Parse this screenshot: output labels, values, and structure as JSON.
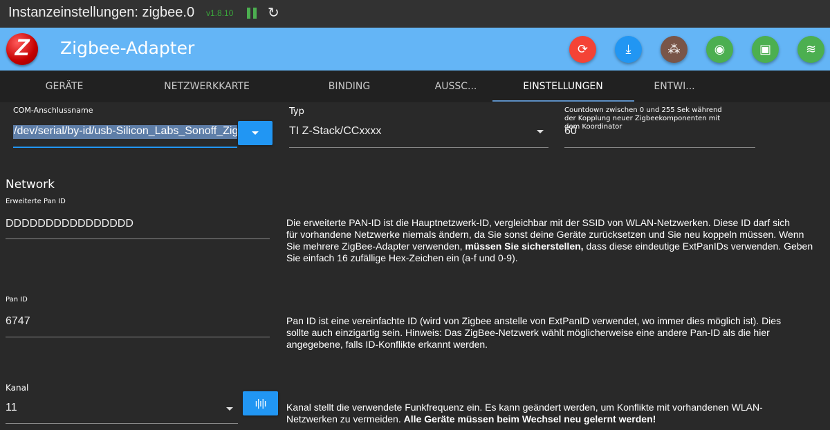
{
  "titlebar": {
    "title": "Instanzeinstellungen: zigbee.0",
    "version": "v1.8.10"
  },
  "header": {
    "logo_letter": "Z",
    "app_name": "Zigbee-Adapter",
    "actions": [
      {
        "icon": "sync-icon",
        "color": "#f44336",
        "glyph": "⟳"
      },
      {
        "icon": "phone-download-icon",
        "color": "#2196f3",
        "glyph": "⤓"
      },
      {
        "icon": "dots-icon",
        "color": "#795548",
        "glyph": "⁂"
      },
      {
        "icon": "access-point-icon",
        "color": "#4caf50",
        "glyph": "◉"
      },
      {
        "icon": "chip-icon",
        "color": "#4caf50",
        "glyph": "▣"
      },
      {
        "icon": "signal-icon",
        "color": "#4caf50",
        "glyph": "≋"
      }
    ]
  },
  "tabs": [
    "GERÄTE",
    "NETZWERKKARTE",
    "BINDING",
    "AUSSC...",
    "EINSTELLUNGEN",
    "ENTWI..."
  ],
  "com": {
    "label": "COM-Anschlussname",
    "value": "/dev/serial/by-id/usb-Silicon_Labs_Sonoff_Zig"
  },
  "typ": {
    "label": "Typ",
    "value": "TI Z-Stack/CCxxxx"
  },
  "countdown": {
    "label": "Countdown zwischen 0 und 255 Sek während der Kopplung neuer Zigbeekomponenten mit dem Koordinator",
    "value": "60"
  },
  "network": {
    "heading": "Network",
    "ext_pan": {
      "label": "Erweiterte Pan ID",
      "value": "DDDDDDDDDDDDDDDD",
      "desc1": "Die erweiterte PAN-ID ist die Hauptnetzwerk-ID, vergleichbar mit der SSID von WLAN-Netzwerken. Diese ID darf sich",
      "desc2": "für vorhandene Netzwerke niemals ändern, da Sie sonst deine Geräte zurücksetzen und Sie neu koppeln müssen. Wenn",
      "desc3a": "Sie mehrere ZigBee-Adapter verwenden, ",
      "desc3b": "müssen Sie sicherstellen,",
      "desc3c": " dass diese eindeutige ExtPanIDs verwenden. Geben",
      "desc4": "Sie einfach 16 zufällige Hex-Zeichen ein (a-f und 0-9)."
    },
    "pan": {
      "label": "Pan ID",
      "value": "6747",
      "desc1": "Pan ID ist eine vereinfachte ID (wird von Zigbee anstelle von ExtPanID verwendet, wo immer dies möglich ist). Dies",
      "desc2": "sollte auch einzigartig sein. Hinweis: Das ZigBee-Netzwerk wählt möglicherweise eine andere Pan-ID als die hier",
      "desc3": "angegebene, falls ID-Konflikte erkannt werden."
    },
    "channel": {
      "label": "Kanal",
      "value": "11",
      "desc1": "Kanal stellt die verwendete Funkfrequenz ein. Es kann geändert werden, um Konflikte mit vorhandenen WLAN-",
      "desc2a": "Netzwerken zu vermeiden. ",
      "desc2b": "Alle Geräte müssen beim Wechsel neu gelernt werden!"
    }
  }
}
